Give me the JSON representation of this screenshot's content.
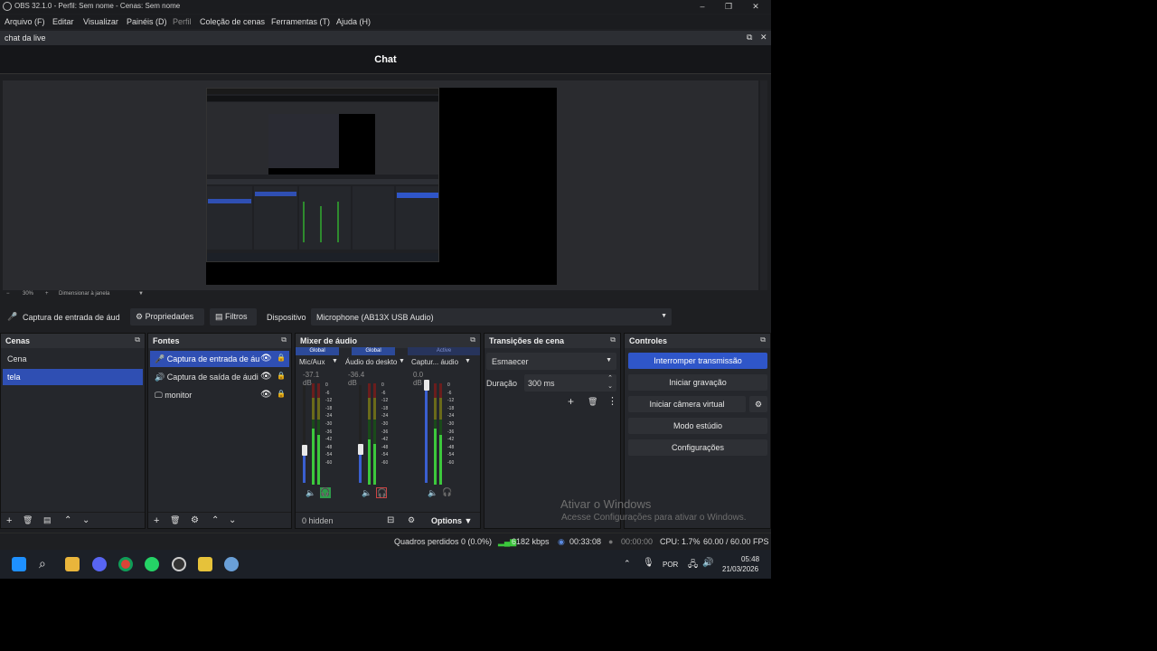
{
  "window": {
    "title": "OBS 32.1.0 - Perfil: Sem nome - Cenas: Sem nome"
  },
  "menu": {
    "items": [
      "Arquivo (F)",
      "Editar",
      "Visualizar",
      "Painéis (D)",
      "Perfil",
      "Coleção de cenas",
      "Ferramentas (T)",
      "Ajuda (H)"
    ]
  },
  "chat_dock": {
    "title": "chat da live",
    "body_title": "Chat"
  },
  "preview": {
    "zoom": "30%",
    "scale_mode": "Dimensionar à janela"
  },
  "context_bar": {
    "source": "Captura de entrada de áud",
    "properties": "Propriedades",
    "filters": "Filtros",
    "device_label": "Dispositivo",
    "device_value": "Microphone (AB13X USB Audio)"
  },
  "scenes": {
    "title": "Cenas",
    "items": [
      "Cena",
      "tela"
    ],
    "selected": "tela"
  },
  "sources": {
    "title": "Fontes",
    "items": [
      "Captura de entrada de áu",
      "Captura de saída de áudi",
      "monitor"
    ]
  },
  "mixer": {
    "title": "Mixer de áudio",
    "channels": [
      {
        "badge": "Global",
        "name": "Mic/Aux",
        "db": "-37.1 dB",
        "fader_level": 0.33,
        "meter_level": 0.55
      },
      {
        "badge": "Global",
        "name": "Áudio do deskto",
        "db": "-36.4 dB",
        "fader_level": 0.34,
        "meter_level": 0.45
      },
      {
        "badge": "Active",
        "name": "Captur... áudio",
        "db": "0.0 dB",
        "fader_level": 1.0,
        "meter_level": 0.55
      }
    ],
    "scale": [
      "0",
      "-6",
      "-12",
      "-18",
      "-24",
      "-30",
      "-36",
      "-42",
      "-48",
      "-54",
      "-60"
    ],
    "hidden_count": "0 hidden",
    "options": "Options"
  },
  "transitions": {
    "title": "Transições de cena",
    "selected": "Esmaecer",
    "duration_label": "Duração",
    "duration_value": "300 ms"
  },
  "controls": {
    "title": "Controles",
    "stop_stream": "Interromper transmissão",
    "start_record": "Iniciar gravação",
    "start_vcam": "Iniciar câmera virtual",
    "studio_mode": "Modo estúdio",
    "settings": "Configurações"
  },
  "watermark": {
    "line1": "Ativar o Windows",
    "line2": "Acesse Configurações para ativar o Windows."
  },
  "status": {
    "dropped": "Quadros perdidos 0 (0.0%)",
    "bitrate": "6182 kbps",
    "stream_time": "00:33:08",
    "rec_time": "00:00:00",
    "cpu": "CPU: 1.7%",
    "fps": "60.00 / 60.00 FPS"
  },
  "taskbar": {
    "lang": "POR",
    "time": "05:48",
    "date": "21/03/2026"
  },
  "colors": {
    "accent": "#2f56c9",
    "selection": "#2f4fb3",
    "meter_green": "#3cc83c"
  }
}
